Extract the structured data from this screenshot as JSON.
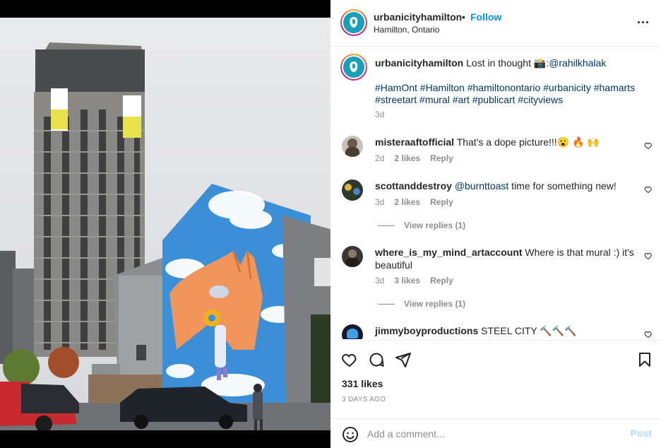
{
  "header": {
    "username": "urbanicityhamilton",
    "dot": "•",
    "follow_label": "Follow",
    "location": "Hamilton, Ontario"
  },
  "caption": {
    "username": "urbanicityhamilton",
    "text_before": "Lost in thought 📸:",
    "mention": "@rahilkhalak",
    "hashtags_line1": "#HamOnt #Hamilton #hamiltonontario #urbanicity #hamarts",
    "hashtags_line2": "#streetart #mural #art #publicart #cityviews",
    "time": "3d"
  },
  "comments": [
    {
      "username": "misteraaftofficial",
      "text": "That's a dope picture!!!😮 🔥 🙌",
      "time": "2d",
      "likes": "2 likes",
      "reply": "Reply"
    },
    {
      "username": "scottanddestroy",
      "mention": "@burnttoast",
      "text": " time for something new!",
      "time": "3d",
      "likes": "2 likes",
      "reply": "Reply",
      "view_replies": "View replies (1)"
    },
    {
      "username": "where_is_my_mind_artaccount",
      "text": "Where is that mural :) it's beautiful",
      "time": "3d",
      "likes": "3 likes",
      "reply": "Reply",
      "view_replies": "View replies (1)"
    },
    {
      "username": "jimmyboyproductions",
      "text": "STEEL CITY 🔨🔨🔨"
    }
  ],
  "post": {
    "likes": "331 likes",
    "ago": "3 DAYS AGO"
  },
  "add_comment": {
    "placeholder": "Add a comment...",
    "post_label": "Post"
  },
  "icons": [
    "more-icon",
    "heart-icon",
    "comment-icon",
    "share-icon",
    "bookmark-icon",
    "emoji-icon"
  ],
  "colors": {
    "accent": "#0095f6",
    "post_disabled": "#b3dbff",
    "brand": "#1b9fb8",
    "sky": "#3a8fd6"
  }
}
